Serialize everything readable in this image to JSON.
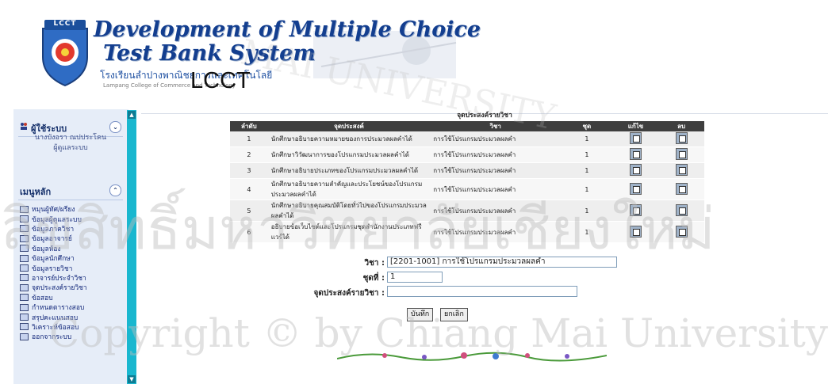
{
  "header": {
    "logo_text": "LCCT",
    "title_line1": "Development of Multiple Choice",
    "title_line2": "Test Bank System",
    "school_th": "โรงเรียนลำปางพาณิชยการและเทคโนโลยี",
    "school_en": "Lampang College of Commerce and Technology",
    "school_abbr": "LCCT"
  },
  "sidebar": {
    "user_panel": {
      "title": "ผู้ใช้ระบบ",
      "toggle": "⌄",
      "text": [
        "นางบังอรา ณปประโคน",
        "ผู้ดูแลระบบ"
      ]
    },
    "menu_panel": {
      "title": "เมนูหลัก",
      "toggle": "⌃"
    },
    "menu_items": [
      "หมุนผู้ทัศ/ผรียง",
      "ข้อมูลผู้ดูแลระบบ",
      "ข้อมูลภาควิชา",
      "ข้อมูลอาจารย์",
      "ข้อมูลห้อง",
      "ข้อมูลนักศึกษา",
      "ข้อมูลรายวิชา",
      "อาจารย์ประจำวิชา",
      "จุดประสงค์รายวิชา",
      "ข้อสอบ",
      "กำหนดตารางสอบ",
      "สรุปคะแนนสอบ",
      "วิเคราะห์ข้อสอบ",
      "ออกจากระบบ"
    ],
    "scroll_up": "▲",
    "scroll_down": "▼"
  },
  "content": {
    "title": "จุดประสงค์รายวิชา",
    "table": {
      "headers": [
        "ลำดับ",
        "จุดประสงค์",
        "วิชา",
        "ชุด",
        "แก้ไข",
        "ลบ"
      ],
      "rows": [
        {
          "no": "1",
          "objective": "นักศึกษาอธิบายความหมายของการประมวลผลคำได้",
          "subject": "การใช้โปรแกรมประมวลผลคำ",
          "set": "1"
        },
        {
          "no": "2",
          "objective": "นักศึกษาวิวัฒนาการของโปรแกรมประมวลผลคำได้",
          "subject": "การใช้โปรแกรมประมวลผลคำ",
          "set": "1"
        },
        {
          "no": "3",
          "objective": "นักศึกษาอธิบายประเภทของโปรแกรมประมวลผลคำได้",
          "subject": "การใช้โปรแกรมประมวลผลคำ",
          "set": "1"
        },
        {
          "no": "4",
          "objective": "นักศึกษาอธิบายความสำคัญและประโยชน์ของโปรแกรมประมวลผลคำได้",
          "subject": "การใช้โปรแกรมประมวลผลคำ",
          "set": "1"
        },
        {
          "no": "5",
          "objective": "นักศึกษาอธิบายคุณสมบัติโดยทั่วไปของโปรแกรมประมวลผลคำได้",
          "subject": "การใช้โปรแกรมประมวลผลคำ",
          "set": "1"
        },
        {
          "no": "6",
          "objective": "อธิบายข้อเว็บไซต์และโปรแกรมชุดสำนักงานประเภทฟรีแวร์ได้",
          "subject": "การใช้โปรแกรมประมวลผลคำ",
          "set": "1"
        }
      ]
    },
    "form": {
      "subject_label": "วิชา :",
      "subject_value": "[2201-1001] การใช้โปรแกรมประมวลผลคำ",
      "set_label": "ชุดที่ :",
      "set_value": "1",
      "objective_label": "จุดประสงค์รายวิชา :",
      "objective_value": "",
      "save_label": "บันทึก",
      "cancel_label": "ยกเลิก"
    }
  },
  "watermark": {
    "line_thai": "ลิขสิทธิ์มหาวิทยาลัยเชียงใหม่",
    "line_en": "Copyright © by Chiang Mai University",
    "arc_text": "MAI UNIVERSITY"
  },
  "colors": {
    "title_blue": "#133e8f",
    "sidebar_bg": "#e6edf8",
    "scrollbar": "#19b7cf",
    "table_header": "#3e3e3e"
  }
}
